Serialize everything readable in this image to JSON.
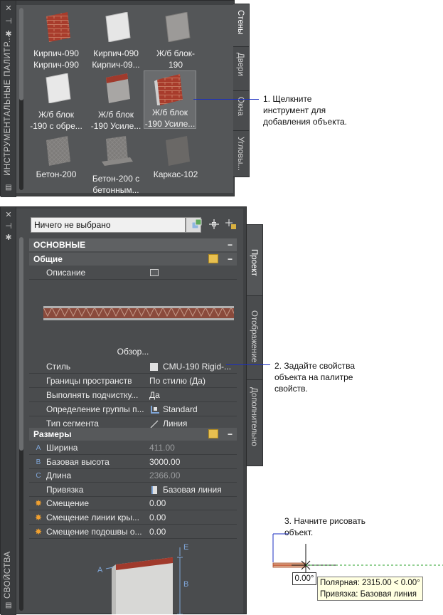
{
  "tool_palette": {
    "title": "ИНСТРУМЕНТАЛЬНЫЕ ПАЛИТР...",
    "tabs": [
      {
        "label": "Стены",
        "active": true
      },
      {
        "label": "Двери",
        "active": false
      },
      {
        "label": "Окна",
        "active": false
      },
      {
        "label": "Угловы...",
        "active": false
      }
    ],
    "tools": [
      {
        "line1": "Кирпич-090",
        "line2": "Кирпич-090",
        "swatch": "brick"
      },
      {
        "line1": "Кирпич-090",
        "line2": "Кирпич-09...",
        "swatch": "white"
      },
      {
        "line1": "Ж/б блок-",
        "line2": "190",
        "swatch": "gray"
      },
      {
        "line1": "Ж/б блок",
        "line2": "-190 с обре...",
        "swatch": "white"
      },
      {
        "line1": "Ж/б блок",
        "line2": "-190 Усиле...",
        "swatch": "brickgray"
      },
      {
        "line1": "Ж/б блок",
        "line2": "-190 Усиле...",
        "swatch": "brick",
        "selected": true
      },
      {
        "line1": "Бетон-200",
        "line2": "",
        "swatch": "concrete"
      },
      {
        "line1": "Бетон-200 с",
        "line2": "бетонным...",
        "swatch": "concrete"
      },
      {
        "line1": "Каркас-102",
        "line2": "",
        "swatch": "dark"
      }
    ]
  },
  "properties": {
    "title": "СВОЙСТВА",
    "tabs": [
      {
        "label": "Проект",
        "active": true
      },
      {
        "label": "Отображение",
        "active": false
      },
      {
        "label": "Дополнительно",
        "active": false
      }
    ],
    "selection": "Ничего не выбрано",
    "section_basic": "ОСНОВНЫЕ",
    "group_general": "Общие",
    "description_label": "Описание",
    "browse_label": "Обзор...",
    "general_rows": [
      {
        "name": "Стиль",
        "value": "CMU-190 Rigid-...",
        "icon": "style"
      },
      {
        "name": "Границы пространств",
        "value": "По стилю (Да)"
      },
      {
        "name": "Выполнять подчистку...",
        "value": "Да"
      },
      {
        "name": "Определение группы п...",
        "value": "Standard",
        "icon": "group"
      },
      {
        "name": "Тип сегмента",
        "value": "Линия",
        "icon": "line"
      }
    ],
    "group_dimensions": "Размеры",
    "dimension_rows": [
      {
        "prefix": "A",
        "name": "Ширина",
        "value": "411.00",
        "dim": true
      },
      {
        "prefix": "B",
        "name": "Базовая высота",
        "value": "3000.00"
      },
      {
        "prefix": "C",
        "name": "Длина",
        "value": "2366.00",
        "dim": true
      },
      {
        "prefix": "",
        "name": "Привязка",
        "value": "Базовая линия",
        "icon": "anchor"
      },
      {
        "prefix": "*",
        "name": "Смещение",
        "value": "0.00"
      },
      {
        "prefix": "*",
        "name": "Смещение линии кры...",
        "value": "0.00"
      },
      {
        "prefix": "*",
        "name": "Смещение подошвы о...",
        "value": "0.00"
      }
    ],
    "diagram_labels": {
      "a": "A",
      "b": "B",
      "e": "E"
    }
  },
  "callouts": {
    "step1": [
      "1. Щелкните",
      "инструмент для",
      "добавления объекта."
    ],
    "step2": [
      "2. Задайте свойства",
      "объекта на палитре",
      "свойств."
    ],
    "step3": [
      "3. Начните рисовать",
      "объект."
    ]
  },
  "drawing": {
    "angle_box": "0.00°",
    "tooltip_line1": "Полярная: 2315.00 < 0.00°",
    "tooltip_line2": "Привязка: Базовая линия"
  },
  "colors": {
    "accent_line": "#1b2fc0",
    "tooltip_bg": "#ffffe1",
    "palette_bg": "#3f4143"
  }
}
